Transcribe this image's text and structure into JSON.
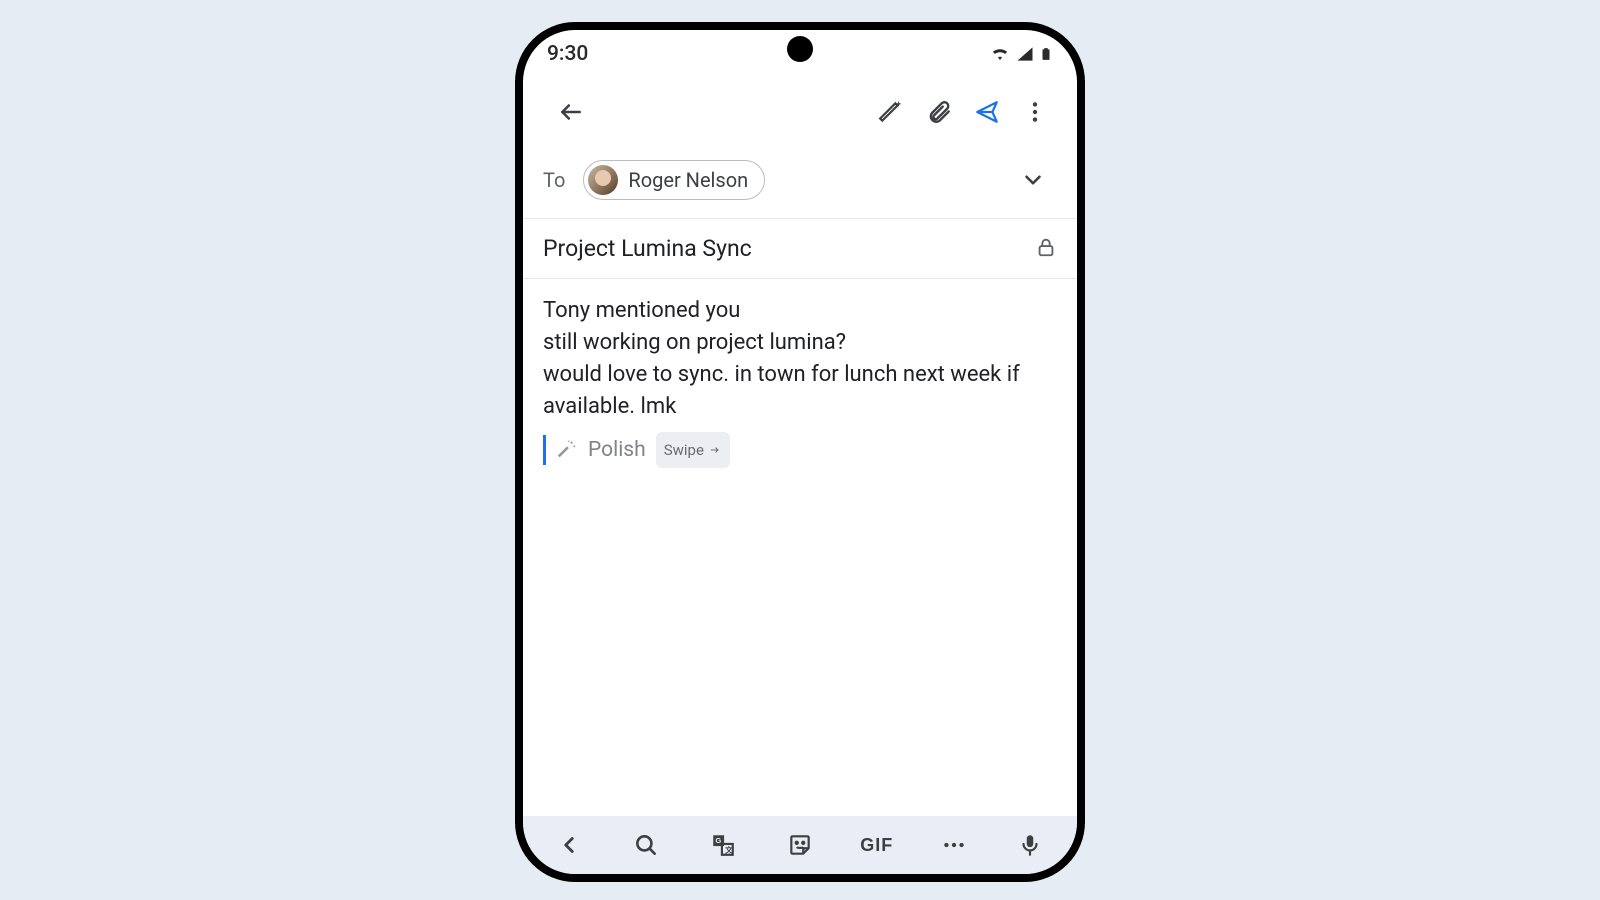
{
  "statusbar": {
    "time": "9:30"
  },
  "compose": {
    "to_label": "To",
    "recipient_name": "Roger Nelson",
    "subject": "Project Lumina Sync",
    "body": "Tony mentioned you\nstill working on project lumina?\nwould love to sync. in town for lunch next week if available. lmk",
    "polish_label": "Polish",
    "swipe_label": "Swipe"
  },
  "keyboard": {
    "gif_label": "GIF"
  }
}
